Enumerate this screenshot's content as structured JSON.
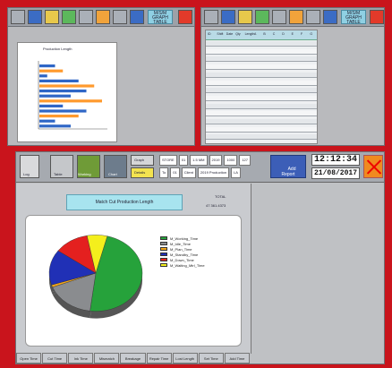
{
  "top_left": {
    "toolbar": {
      "buttons": [
        "tool-1",
        "tool-2",
        "tool-3",
        "tool-4",
        "tool-5",
        "tool-6",
        "tool-7",
        "tool-8"
      ],
      "right_label": "M/S/M\nGRAPH\nTABLE",
      "close": "close"
    },
    "chart": {
      "title": "Production Length",
      "bars": [
        2,
        3,
        1,
        5,
        7,
        6,
        4,
        8,
        3,
        6,
        5,
        2,
        4
      ]
    }
  },
  "top_right": {
    "toolbar": {
      "buttons": [
        "tool-1",
        "tool-2",
        "tool-3",
        "tool-4",
        "tool-5",
        "tool-6",
        "tool-7",
        "tool-8"
      ],
      "right_label": "M/S/M\nGRAPH\nTABLE",
      "close": "close"
    },
    "table": {
      "header": [
        "ID",
        "Shift",
        "Date",
        "Qty",
        "Length",
        "A",
        "B",
        "C",
        "D",
        "E",
        "F",
        "G"
      ],
      "rows": 13
    }
  },
  "main": {
    "toolbar": {
      "buttons": [
        {
          "name": "logo",
          "label": "Log"
        },
        {
          "name": "table",
          "label": "Table"
        },
        {
          "name": "working",
          "label": "Working"
        },
        {
          "name": "chart",
          "label": "Chart"
        },
        {
          "name": "graph",
          "label": "Graph"
        },
        {
          "name": "details",
          "label": "Details"
        }
      ],
      "form_rows": [
        [
          "STORE",
          "01",
          "1.5 MM",
          "2019",
          "1000",
          "127"
        ],
        [
          "To",
          "01",
          "Client",
          "2019 Production",
          "LA"
        ]
      ],
      "report_button": "Add\nReport",
      "time": "12:12:34",
      "date": "21/08/2017"
    },
    "title": "Match Cut Production Length",
    "subtitle": "TOTAL",
    "subtitle_value": "47 361.4373",
    "pie": {
      "slices": [
        {
          "label": "M_Working_Time",
          "value": 48,
          "color": "#26a23b"
        },
        {
          "label": "M_Idle_Time",
          "value": 17,
          "color": "#8a8c8f"
        },
        {
          "label": "M_Plan_Time",
          "value": 1,
          "color": "#f2a61a"
        },
        {
          "label": "M_Standby_Time",
          "value": 15,
          "color": "#2030b6"
        },
        {
          "label": "M_Down_Time",
          "value": 12,
          "color": "#e4201f"
        },
        {
          "label": "M_Waiting_Mtrl_Time",
          "value": 7,
          "color": "#f4ef1c"
        }
      ]
    },
    "bottom_buttons": [
      "Open Time",
      "Cut Time",
      "Ink Time",
      "Mismatch Time",
      "Breakage Time",
      "Repair Time",
      "Lost Length",
      "Set Time",
      "Add Time"
    ]
  },
  "colors": {
    "frame": "#c9141c",
    "toolbar": "#9da1a8",
    "panel": "#8fd0e3"
  }
}
